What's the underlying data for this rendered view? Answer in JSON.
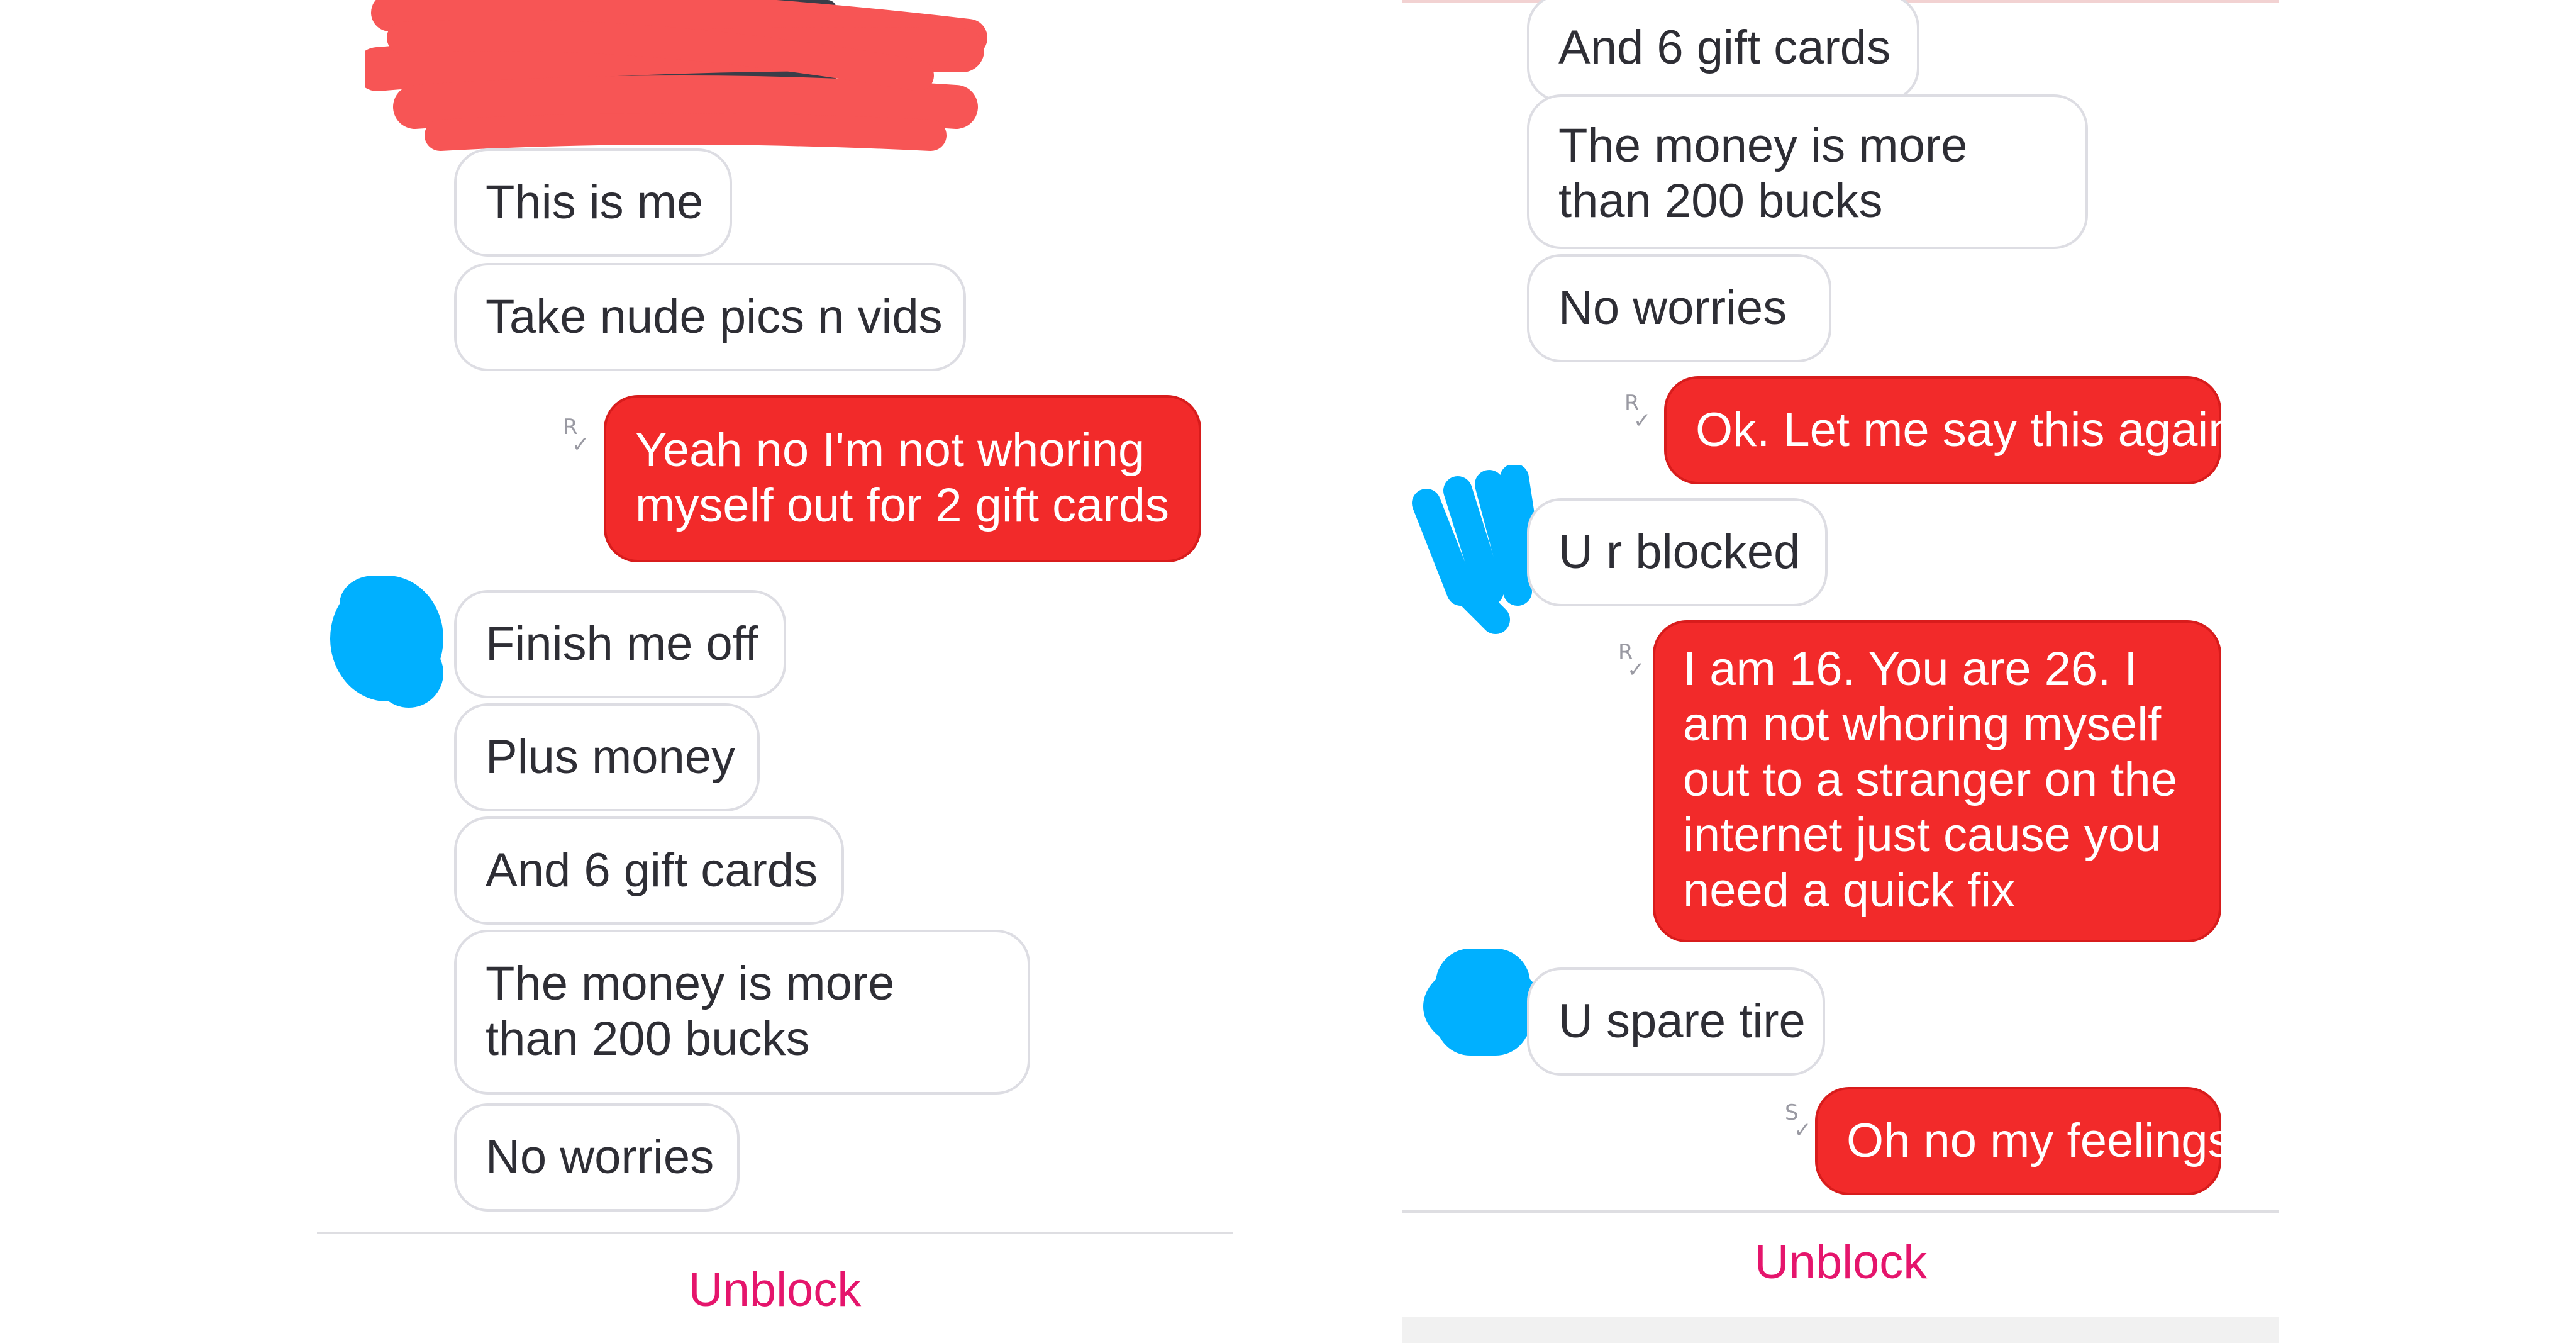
{
  "left": {
    "messages": [
      {
        "dir": "in",
        "text": "This is me"
      },
      {
        "dir": "in",
        "text": "Take nude pics n vids"
      },
      {
        "dir": "out",
        "text": "Yeah no I'm not whoring myself out for 2 gift cards",
        "receipt": "R"
      },
      {
        "dir": "in",
        "text": "Finish me off"
      },
      {
        "dir": "in",
        "text": "Plus money"
      },
      {
        "dir": "in",
        "text": "And 6 gift cards"
      },
      {
        "dir": "in",
        "text": "The money is more than 200 bucks"
      },
      {
        "dir": "in",
        "text": "No worries"
      }
    ],
    "unblock_label": "Unblock"
  },
  "right": {
    "messages": [
      {
        "dir": "in",
        "text": "And 6 gift cards"
      },
      {
        "dir": "in",
        "text": "The money is more than 200 bucks"
      },
      {
        "dir": "in",
        "text": "No worries"
      },
      {
        "dir": "out",
        "text": "Ok. Let me say this again.",
        "receipt": "R"
      },
      {
        "dir": "in",
        "text": "U r blocked"
      },
      {
        "dir": "out",
        "text": "I am 16. You are 26. I am not whoring myself out to a stranger on the internet just cause you need a quick fix",
        "receipt": "R"
      },
      {
        "dir": "in",
        "text": "U spare tire"
      },
      {
        "dir": "out",
        "text": "Oh no my feelings",
        "receipt": "S"
      }
    ],
    "unblock_label": "Unblock"
  },
  "colors": {
    "outgoing_bubble": "#f22a2a",
    "incoming_border": "#dddde3",
    "unblock_text": "#e5156c",
    "redaction_red": "#f75555",
    "avatar_scribble": "#00b0ff"
  }
}
